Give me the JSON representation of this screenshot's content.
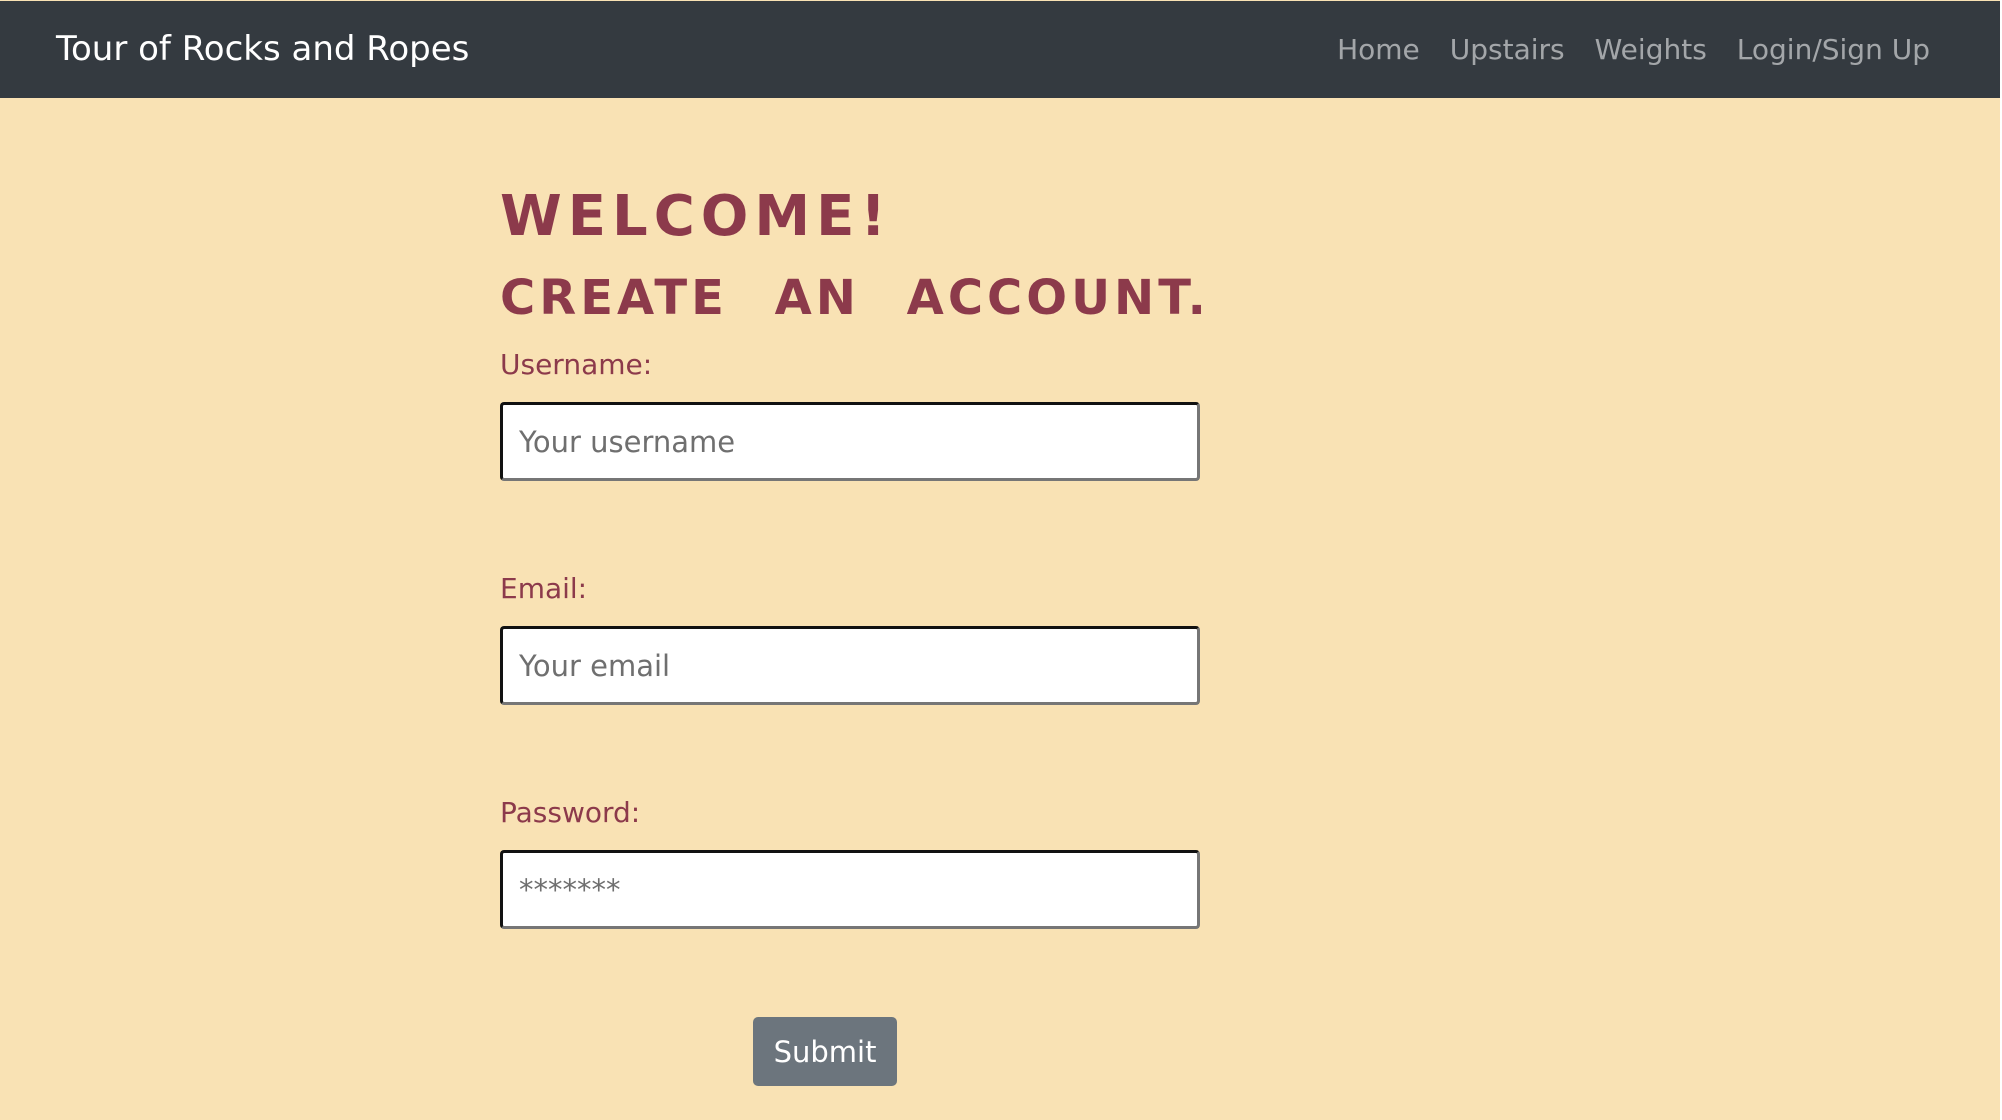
{
  "navbar": {
    "brand": "Tour of Rocks and Ropes",
    "links": [
      "Home",
      "Upstairs",
      "Weights",
      "Login/Sign Up"
    ]
  },
  "headings": {
    "welcome": "Welcome!",
    "create": "Create an account."
  },
  "form": {
    "username": {
      "label": "Username:",
      "placeholder": "Your username",
      "value": ""
    },
    "email": {
      "label": "Email:",
      "placeholder": "Your email",
      "value": ""
    },
    "password": {
      "label": "Password:",
      "placeholder": "*******",
      "value": ""
    },
    "submit_label": "Submit"
  },
  "colors": {
    "navbar_bg": "#343a40",
    "page_bg": "#f9e2b4",
    "accent": "#8c3a4b",
    "button_bg": "#6c757d"
  }
}
